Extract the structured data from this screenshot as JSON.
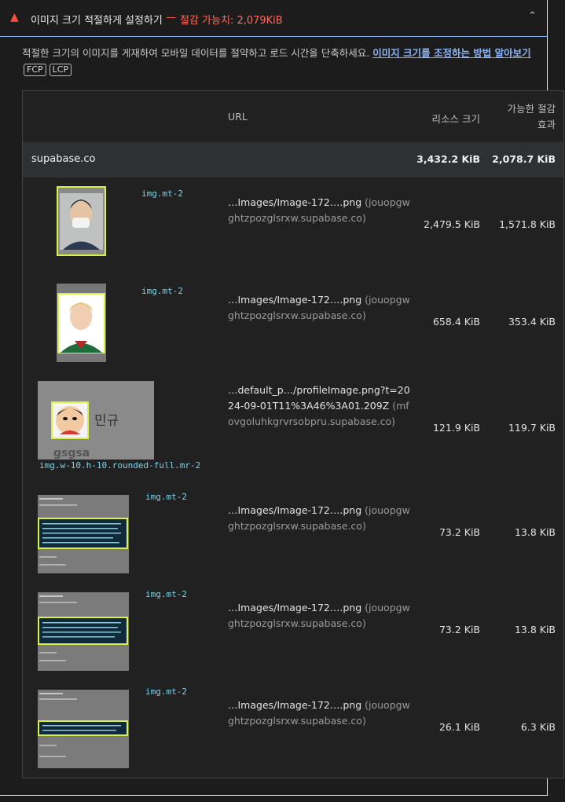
{
  "audit": {
    "icon": "warning-triangle-icon",
    "title": "이미지 크기 적절하게 설정하기",
    "separator": "—",
    "savings": "절감 가능치: 2,079KiB",
    "description": "적절한 크기의 이미지를 게재하여 모바일 데이터를 절약하고 로드 시간을 단축하세요.",
    "learn_more": "이미지 크기를 조정하는 방법 알아보기",
    "tags": [
      "FCP",
      "LCP"
    ]
  },
  "table": {
    "headers": {
      "url": "URL",
      "resource_size": "리소스 크기",
      "potential_savings": "가능한 절감 효과"
    },
    "group": {
      "name": "supabase.co",
      "resource_size": "3,432.2 KiB",
      "potential_savings": "2,078.7 KiB"
    },
    "rows": [
      {
        "snippet": "img.mt-2",
        "url_path": "…Images/Image-172….png",
        "host": "(jouopgwghtzpozglsrxw.supabase.co)",
        "resource_size": "2,479.5 KiB",
        "potential_savings": "1,571.8 KiB",
        "thumb": "portrait-mask"
      },
      {
        "snippet": "img.mt-2",
        "url_path": "…Images/Image-172….png",
        "host": "(jouopgwghtzpozglsrxw.supabase.co)",
        "resource_size": "658.4 KiB",
        "potential_savings": "353.4 KiB",
        "thumb": "portrait-blond"
      },
      {
        "snippet": "img.w-10.h-10.rounded-full.mr-2",
        "url_path": "…default_p…/profileImage.png?t=2024-09-01T11%3A46%3A01.209Z",
        "host": "(mfovgoluhkgrvrsobpru.supabase.co)",
        "resource_size": "121.9 KiB",
        "potential_savings": "119.7 KiB",
        "thumb": "profile-card",
        "thumb_text": [
          "민규",
          "gsgsa"
        ]
      },
      {
        "snippet": "img.mt-2",
        "url_path": "…Images/Image-172….png",
        "host": "(jouopgwghtzpozglsrxw.supabase.co)",
        "resource_size": "73.2 KiB",
        "potential_savings": "13.8 KiB",
        "thumb": "screenshot-table"
      },
      {
        "snippet": "img.mt-2",
        "url_path": "…Images/Image-172….png",
        "host": "(jouopgwghtzpozglsrxw.supabase.co)",
        "resource_size": "73.2 KiB",
        "potential_savings": "13.8 KiB",
        "thumb": "screenshot-table"
      },
      {
        "snippet": "img.mt-2",
        "url_path": "…Images/Image-172….png",
        "host": "(jouopgwghtzpozglsrxw.supabase.co)",
        "resource_size": "26.1 KiB",
        "potential_savings": "6.3 KiB",
        "thumb": "screenshot-strip"
      }
    ]
  },
  "colors": {
    "fail": "#ff4e42",
    "link": "#8ab4f8",
    "highlight": "#d9ef4c",
    "snippet": "#7fd3e8"
  }
}
